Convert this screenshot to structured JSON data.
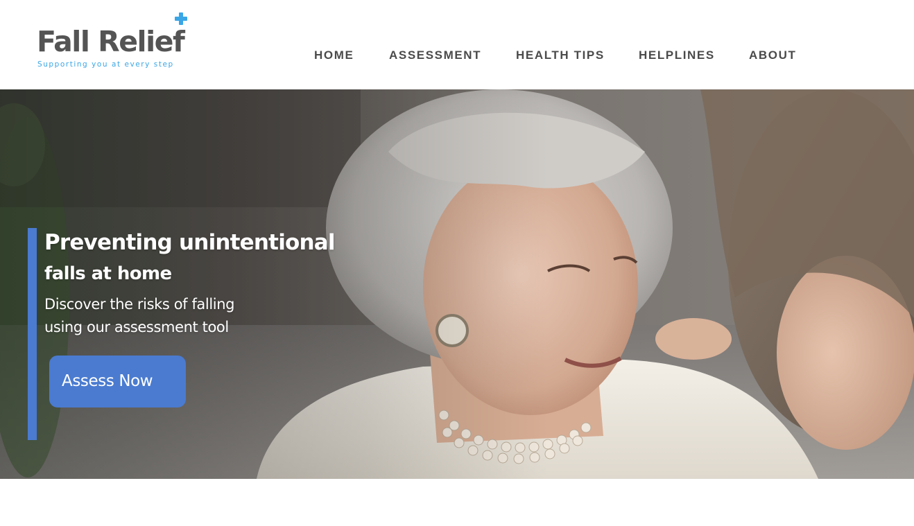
{
  "brand": {
    "name": "Fall Relief",
    "tagline": "Supporting you at every step",
    "icon": "plus-icon",
    "colors": {
      "logo_text": "#545454",
      "accent_blue": "#3aa6e6",
      "button_blue": "#4a7bd0",
      "nav_text": "#4a4a4a"
    }
  },
  "nav": {
    "items": [
      {
        "label": "HOME"
      },
      {
        "label": "ASSESSMENT"
      },
      {
        "label": "HEALTH TIPS"
      },
      {
        "label": "HELPLINES"
      },
      {
        "label": "ABOUT"
      }
    ]
  },
  "hero": {
    "title_line1": "Preventing unintentional",
    "title_line2": "falls at home",
    "subtitle_line1": "Discover the risks of falling",
    "subtitle_line2": "using our assessment tool",
    "cta_label": "Assess Now",
    "image": "photo-elderly-woman-with-caregiver"
  }
}
